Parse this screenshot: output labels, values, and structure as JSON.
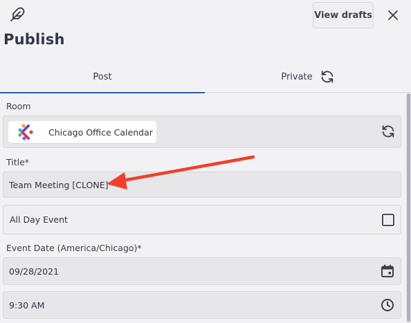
{
  "header": {
    "icon": "feather-icon",
    "title": "Publish",
    "view_drafts_label": "View drafts",
    "close_icon": "close-icon"
  },
  "tabs": [
    {
      "label": "Post",
      "active": true
    },
    {
      "label": "Private",
      "active": false,
      "icon": "refresh-icon"
    }
  ],
  "form": {
    "room": {
      "label": "Room",
      "value": "Chicago Office Calendar",
      "icon": "refresh-icon"
    },
    "title": {
      "label": "Title*",
      "value": "Team Meeting [CLONE]"
    },
    "all_day": {
      "label": "All Day Event",
      "checked": false
    },
    "event_date": {
      "label": "Event Date (America/Chicago)*",
      "date_value": "09/28/2021",
      "time_value": "9:30 AM"
    }
  },
  "annotation": {
    "type": "arrow",
    "color": "#f0402b",
    "points_to": "title-input"
  },
  "colors": {
    "accent": "#2c5ba8",
    "field_bg": "#e7e7ea",
    "page_bg": "#f2f2f4"
  }
}
